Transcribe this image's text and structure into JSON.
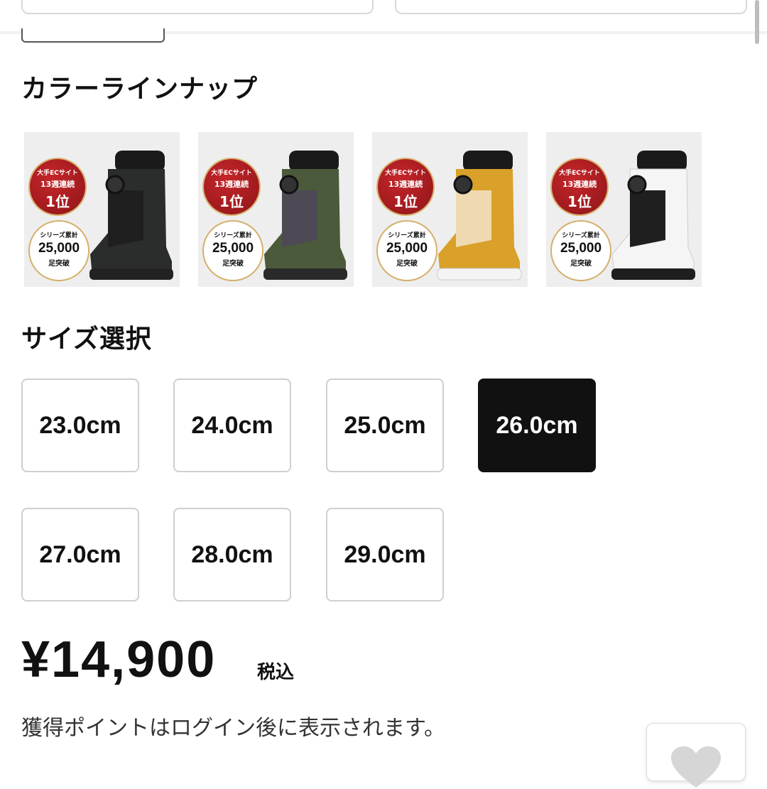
{
  "sections": {
    "color_title": "カラーラインナップ",
    "size_title": "サイズ選択"
  },
  "badges": {
    "rank_line1": "大手ECサイト",
    "rank_line2": "13週連続",
    "rank_line3": "1位",
    "series_line1": "シリーズ累計",
    "series_line2": "25,000",
    "series_line3": "足突破"
  },
  "colors": [
    {
      "name": "black-boot",
      "upper": "#2b2d2c",
      "accent": "#1a1a1a",
      "sole": "#222222"
    },
    {
      "name": "olive-boot",
      "upper": "#4b5a3a",
      "accent": "#4d4a55",
      "sole": "#2a2a2a"
    },
    {
      "name": "mustard-boot",
      "upper": "#d9a02a",
      "accent": "#efd9b0",
      "sole": "#f4f4f4"
    },
    {
      "name": "white-boot",
      "upper": "#f5f5f5",
      "accent": "#e3e3e3",
      "sole": "#1e1e1e"
    }
  ],
  "sizes": [
    {
      "label": "23.0cm",
      "selected": false
    },
    {
      "label": "24.0cm",
      "selected": false
    },
    {
      "label": "25.0cm",
      "selected": false
    },
    {
      "label": "26.0cm",
      "selected": true
    },
    {
      "label": "27.0cm",
      "selected": false
    },
    {
      "label": "28.0cm",
      "selected": false
    },
    {
      "label": "29.0cm",
      "selected": false
    }
  ],
  "price": {
    "amount": "¥14,900",
    "tax_label": "税込"
  },
  "points_note": "獲得ポイントはログイン後に表示されます。",
  "theme": {
    "selected_bg": "#111111",
    "border": "#cfcfcf",
    "badge_red": "#b3202a"
  },
  "icons": {
    "favorite": "heart-icon"
  }
}
